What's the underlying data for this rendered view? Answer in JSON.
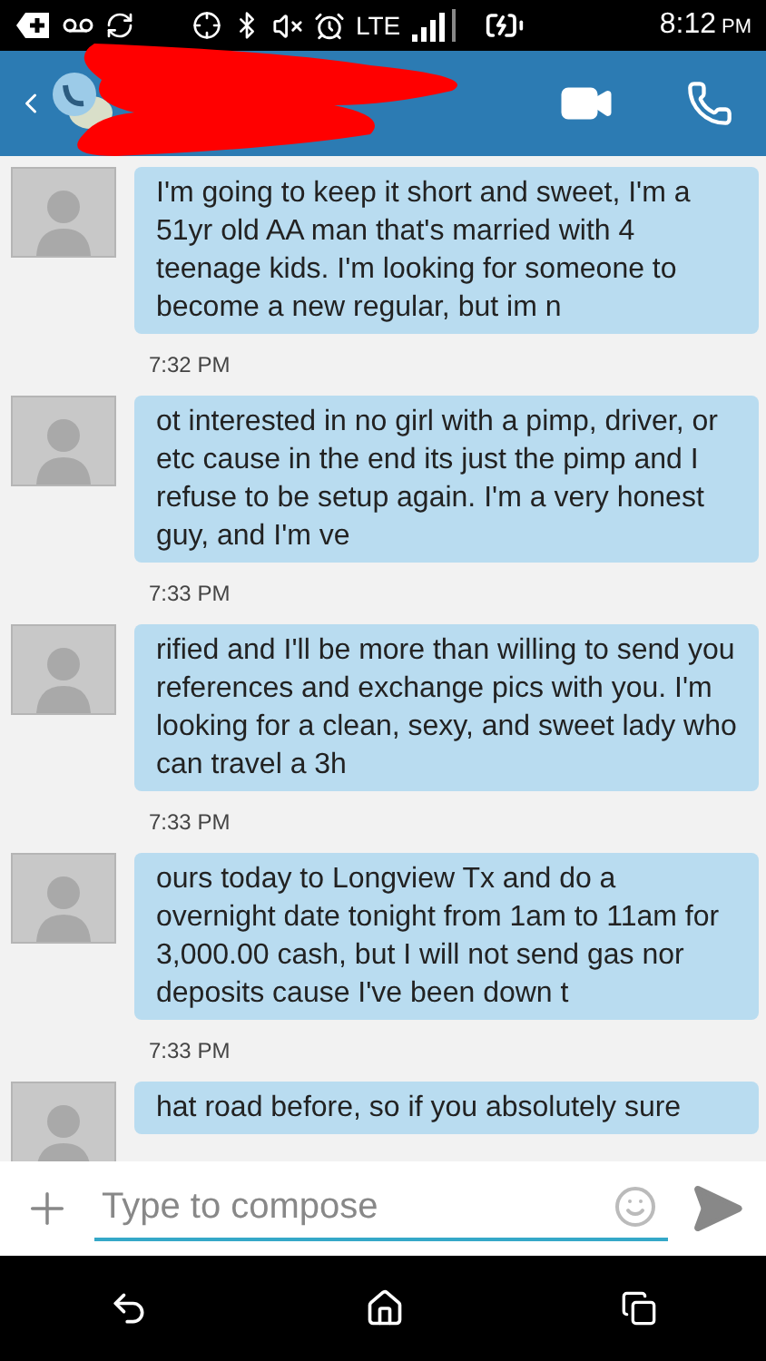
{
  "status_bar": {
    "network": "LTE",
    "time": "8:12",
    "time_suffix": "PM"
  },
  "messages": [
    {
      "text": "I'm going to keep it short and sweet, I'm a 51yr old AA man that's married with 4 teenage kids. I'm looking for someone to become a new regular, but im n",
      "time": "7:32 PM"
    },
    {
      "text": "ot interested in no girl with a pimp, driver, or etc cause in the end its just the pimp and I refuse to be setup again. I'm a very honest guy, and I'm ve",
      "time": "7:33 PM"
    },
    {
      "text": "rified and I'll be more than willing to send you references and exchange pics with you. I'm looking for a clean, sexy, and sweet lady who can travel a 3h",
      "time": "7:33 PM"
    },
    {
      "text": "ours today to Longview Tx and do a overnight date tonight from 1am to 11am for 3,000.00 cash, but I will not send gas nor deposits cause I've been down t",
      "time": "7:33 PM"
    },
    {
      "text": "hat road before, so if you absolutely sure"
    }
  ],
  "compose": {
    "placeholder": "Type to compose"
  }
}
